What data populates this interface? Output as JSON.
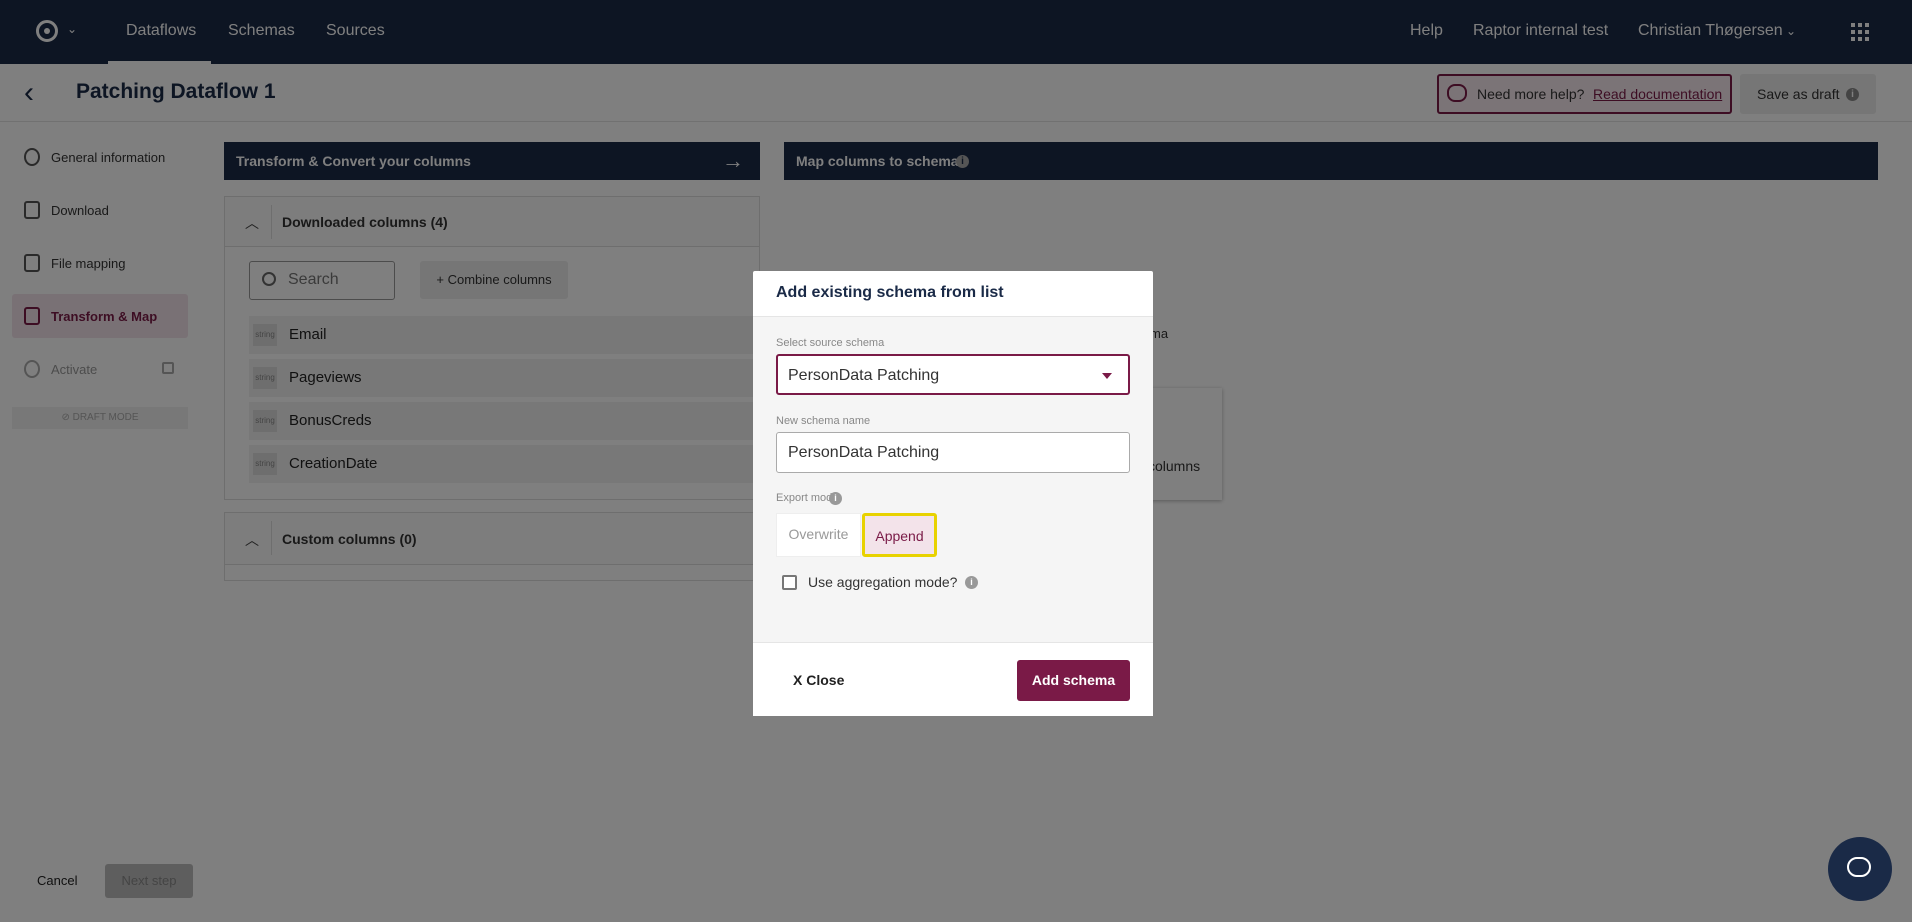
{
  "topnav": {
    "items": [
      "Dataflows",
      "Schemas",
      "Sources"
    ],
    "right_items": [
      "Help",
      "Raptor internal test",
      "Christian Thøgersen"
    ]
  },
  "titlebar": {
    "title": "Patching Dataflow 1",
    "help_text": "Need more help?",
    "help_link": "Read documentation",
    "save_draft": "Save as draft"
  },
  "sidebar": {
    "items": [
      {
        "label": "General information",
        "icon": "gear-icon"
      },
      {
        "label": "Download",
        "icon": "download-icon"
      },
      {
        "label": "File mapping",
        "icon": "document-icon"
      },
      {
        "label": "Transform & Map",
        "icon": "table-icon"
      },
      {
        "label": "Activate",
        "icon": "power-icon"
      }
    ],
    "draft_mode": "⊘ DRAFT MODE"
  },
  "main": {
    "transform_header": "Transform & Convert your columns",
    "map_header": "Map columns to schema",
    "downloaded_columns": "Downloaded columns (4)",
    "search_placeholder": "Search",
    "combine_button": "+ Combine columns",
    "type_badge": "string",
    "columns": [
      "Email",
      "Pageviews",
      "BonusCreds",
      "CreationDate"
    ],
    "custom_columns": "Custom columns (0)",
    "behind_text1": "ma",
    "behind_text2": "columns"
  },
  "footer": {
    "cancel": "Cancel",
    "next": "Next step"
  },
  "modal": {
    "title": "Add existing schema from list",
    "source_label": "Select source schema",
    "source_value": "PersonData Patching",
    "name_label": "New schema name",
    "name_value": "PersonData Patching",
    "export_label": "Export mode",
    "export_options": [
      "Overwrite",
      "Append"
    ],
    "export_selected": "Append",
    "aggregation_label": "Use aggregation mode?",
    "close": "X Close",
    "add": "Add schema"
  },
  "colors": {
    "navy": "#1a2a47",
    "accent": "#7a1a47",
    "highlight": "#e8d200"
  }
}
